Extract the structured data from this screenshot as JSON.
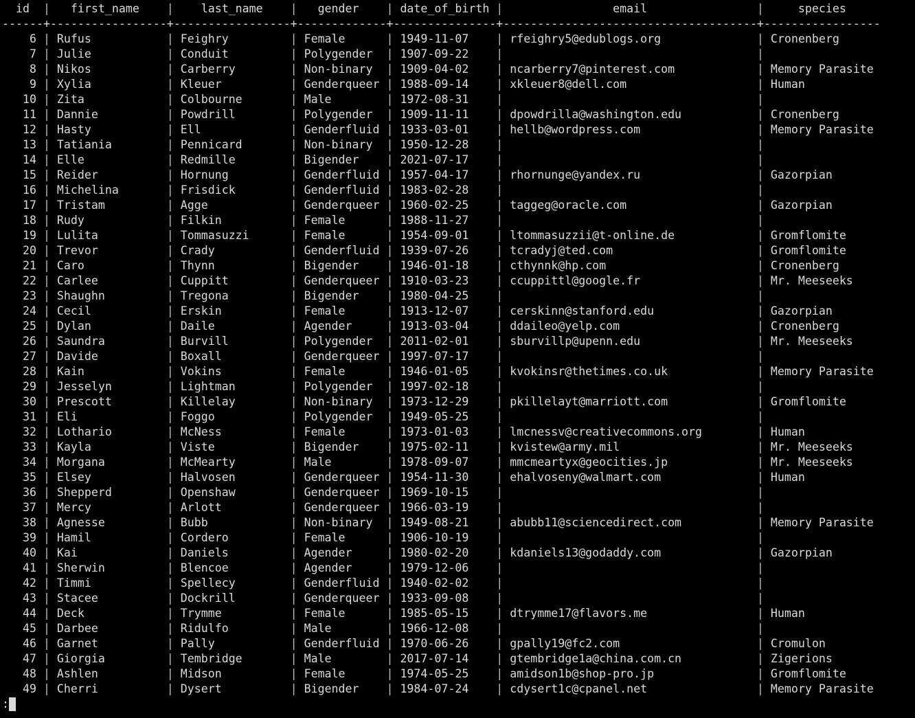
{
  "colors": {
    "background": "#000000",
    "text": "#d9d9d9"
  },
  "table": {
    "columns": [
      {
        "label": "id",
        "align": "right",
        "width": 4
      },
      {
        "label": "first_name",
        "align": "left",
        "width": 15
      },
      {
        "label": "last_name",
        "align": "left",
        "width": 15
      },
      {
        "label": "gender",
        "align": "left",
        "width": 11
      },
      {
        "label": "date_of_birth",
        "align": "left",
        "width": 13
      },
      {
        "label": "email",
        "align": "left",
        "width": 35
      },
      {
        "label": "species",
        "align": "left",
        "width": 15
      }
    ],
    "rows": [
      [
        "6",
        "Rufus",
        "Feighry",
        "Female",
        "1949-11-07",
        "rfeighry5@edublogs.org",
        "Cronenberg"
      ],
      [
        "7",
        "Julie",
        "Conduit",
        "Polygender",
        "1907-09-22",
        "",
        ""
      ],
      [
        "8",
        "Nikos",
        "Carberry",
        "Non-binary",
        "1909-04-02",
        "ncarberry7@pinterest.com",
        "Memory Parasite"
      ],
      [
        "9",
        "Xylia",
        "Kleuer",
        "Genderqueer",
        "1988-09-14",
        "xkleuer8@dell.com",
        "Human"
      ],
      [
        "10",
        "Zita",
        "Colbourne",
        "Male",
        "1972-08-31",
        "",
        ""
      ],
      [
        "11",
        "Dannie",
        "Powdrill",
        "Polygender",
        "1909-11-11",
        "dpowdrilla@washington.edu",
        "Cronenberg"
      ],
      [
        "12",
        "Hasty",
        "Ell",
        "Genderfluid",
        "1933-03-01",
        "hellb@wordpress.com",
        "Memory Parasite"
      ],
      [
        "13",
        "Tatiania",
        "Pennicard",
        "Non-binary",
        "1950-12-28",
        "",
        ""
      ],
      [
        "14",
        "Elle",
        "Redmille",
        "Bigender",
        "2021-07-17",
        "",
        ""
      ],
      [
        "15",
        "Reider",
        "Hornung",
        "Genderfluid",
        "1957-04-17",
        "rhornunge@yandex.ru",
        "Gazorpian"
      ],
      [
        "16",
        "Michelina",
        "Frisdick",
        "Genderfluid",
        "1983-02-28",
        "",
        ""
      ],
      [
        "17",
        "Tristam",
        "Agge",
        "Genderqueer",
        "1960-02-25",
        "taggeg@oracle.com",
        "Gazorpian"
      ],
      [
        "18",
        "Rudy",
        "Filkin",
        "Female",
        "1988-11-27",
        "",
        ""
      ],
      [
        "19",
        "Lulita",
        "Tommasuzzi",
        "Female",
        "1954-09-01",
        "ltommasuzzii@t-online.de",
        "Gromflomite"
      ],
      [
        "20",
        "Trevor",
        "Crady",
        "Genderfluid",
        "1939-07-26",
        "tcradyj@ted.com",
        "Gromflomite"
      ],
      [
        "21",
        "Caro",
        "Thynn",
        "Bigender",
        "1946-01-18",
        "cthynnk@hp.com",
        "Cronenberg"
      ],
      [
        "22",
        "Carlee",
        "Cuppitt",
        "Genderqueer",
        "1910-03-23",
        "ccuppittl@google.fr",
        "Mr. Meeseeks"
      ],
      [
        "23",
        "Shaughn",
        "Tregona",
        "Bigender",
        "1980-04-25",
        "",
        ""
      ],
      [
        "24",
        "Cecil",
        "Erskin",
        "Female",
        "1913-12-07",
        "cerskinn@stanford.edu",
        "Gazorpian"
      ],
      [
        "25",
        "Dylan",
        "Daile",
        "Agender",
        "1913-03-04",
        "ddaileo@yelp.com",
        "Cronenberg"
      ],
      [
        "26",
        "Saundra",
        "Burvill",
        "Polygender",
        "2011-02-01",
        "sburvillp@upenn.edu",
        "Mr. Meeseeks"
      ],
      [
        "27",
        "Davide",
        "Boxall",
        "Genderqueer",
        "1997-07-17",
        "",
        ""
      ],
      [
        "28",
        "Kain",
        "Vokins",
        "Female",
        "1946-01-05",
        "kvokinsr@thetimes.co.uk",
        "Memory Parasite"
      ],
      [
        "29",
        "Jesselyn",
        "Lightman",
        "Polygender",
        "1997-02-18",
        "",
        ""
      ],
      [
        "30",
        "Prescott",
        "Killelay",
        "Non-binary",
        "1973-12-29",
        "pkillelayt@marriott.com",
        "Gromflomite"
      ],
      [
        "31",
        "Eli",
        "Foggo",
        "Polygender",
        "1949-05-25",
        "",
        ""
      ],
      [
        "32",
        "Lothario",
        "McNess",
        "Female",
        "1973-01-03",
        "lmcnessv@creativecommons.org",
        "Human"
      ],
      [
        "33",
        "Kayla",
        "Viste",
        "Bigender",
        "1975-02-11",
        "kvistew@army.mil",
        "Mr. Meeseeks"
      ],
      [
        "34",
        "Morgana",
        "McMearty",
        "Male",
        "1978-09-07",
        "mmcmeartyx@geocities.jp",
        "Mr. Meeseeks"
      ],
      [
        "35",
        "Elsey",
        "Halvosen",
        "Genderqueer",
        "1954-11-30",
        "ehalvoseny@walmart.com",
        "Human"
      ],
      [
        "36",
        "Shepperd",
        "Openshaw",
        "Genderqueer",
        "1969-10-15",
        "",
        ""
      ],
      [
        "37",
        "Mercy",
        "Arlott",
        "Genderqueer",
        "1966-03-19",
        "",
        ""
      ],
      [
        "38",
        "Agnesse",
        "Bubb",
        "Non-binary",
        "1949-08-21",
        "abubb11@sciencedirect.com",
        "Memory Parasite"
      ],
      [
        "39",
        "Hamil",
        "Cordero",
        "Female",
        "1906-10-19",
        "",
        ""
      ],
      [
        "40",
        "Kai",
        "Daniels",
        "Agender",
        "1980-02-20",
        "kdaniels13@godaddy.com",
        "Gazorpian"
      ],
      [
        "41",
        "Sherwin",
        "Blencoe",
        "Agender",
        "1979-12-06",
        "",
        ""
      ],
      [
        "42",
        "Timmi",
        "Spellecy",
        "Genderfluid",
        "1940-02-02",
        "",
        ""
      ],
      [
        "43",
        "Stacee",
        "Dockrill",
        "Genderqueer",
        "1933-09-08",
        "",
        ""
      ],
      [
        "44",
        "Deck",
        "Trymme",
        "Female",
        "1985-05-15",
        "dtrymme17@flavors.me",
        "Human"
      ],
      [
        "45",
        "Darbee",
        "Ridulfo",
        "Male",
        "1966-12-08",
        "",
        ""
      ],
      [
        "46",
        "Garnet",
        "Pally",
        "Genderfluid",
        "1970-06-26",
        "gpally19@fc2.com",
        "Cromulon"
      ],
      [
        "47",
        "Giorgia",
        "Tembridge",
        "Male",
        "2017-07-14",
        "gtembridge1a@china.com.cn",
        "Zigerions"
      ],
      [
        "48",
        "Ashlen",
        "Midson",
        "Female",
        "1974-05-25",
        "amidson1b@shop-pro.jp",
        "Gromflomite"
      ],
      [
        "49",
        "Cherri",
        "Dysert",
        "Bigender",
        "1984-07-24",
        "cdysert1c@cpanel.net",
        "Memory Parasite"
      ]
    ]
  },
  "pager": {
    "prompt": ":"
  }
}
